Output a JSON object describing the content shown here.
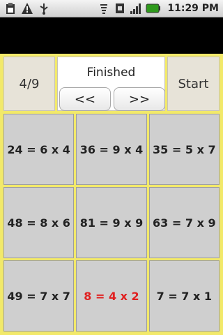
{
  "statusbar": {
    "time": "11:29 PM",
    "icons": [
      "clipboard-icon",
      "warning-icon",
      "usb-icon",
      "wifi-icon",
      "sim-icon",
      "signal-icon",
      "battery-icon"
    ]
  },
  "controls": {
    "progress": "4/9",
    "status": "Finished",
    "prev_label": "<<",
    "next_label": ">>",
    "start_label": "Start"
  },
  "grid": {
    "items": [
      {
        "text": "24 = 6 x 4",
        "state": "normal"
      },
      {
        "text": "36 = 9 x 4",
        "state": "normal"
      },
      {
        "text": "35 = 5 x 7",
        "state": "normal"
      },
      {
        "text": "48 = 8 x 6",
        "state": "normal"
      },
      {
        "text": "81 = 9 x 9",
        "state": "normal"
      },
      {
        "text": "63 = 7 x 9",
        "state": "normal"
      },
      {
        "text": "49 = 7 x 7",
        "state": "normal"
      },
      {
        "text": "8 = 4 x 2",
        "state": "wrong"
      },
      {
        "text": "7 = 7 x 1",
        "state": "normal"
      }
    ]
  },
  "colors": {
    "background": "#f2e96a",
    "tile": "#cfcfcf",
    "wrong_text": "#e02020"
  }
}
